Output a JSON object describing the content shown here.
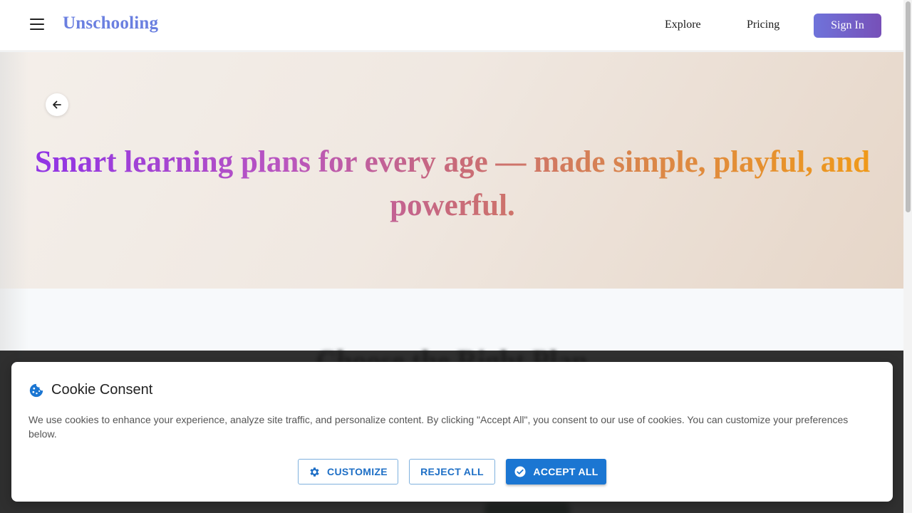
{
  "header": {
    "brand": "Unschooling",
    "nav": [
      {
        "label": "Explore"
      },
      {
        "label": "Pricing"
      }
    ],
    "sign_in": "Sign In"
  },
  "hero": {
    "title": "Smart learning plans for every age — made simple, playful, and powerful."
  },
  "section": {
    "heading": "Choose the Right Plan"
  },
  "cookie_banner": {
    "title": "Cookie Consent",
    "text": "We use cookies to enhance your experience, analyze site traffic, and personalize content. By clicking \"Accept All\", you consent to our use of cookies. You can customize your preferences below.",
    "customize": "CUSTOMIZE",
    "reject": "REJECT ALL",
    "accept": "ACCEPT ALL"
  },
  "colors": {
    "brand": "#6a7fe0",
    "primary_button": "#1b76d2",
    "sign_in_gradient_start": "#6f73da",
    "sign_in_gradient_end": "#7750b8"
  },
  "icons": [
    "menu-icon",
    "arrow-left-icon",
    "cookie-icon",
    "gear-icon",
    "check-circle-icon"
  ]
}
